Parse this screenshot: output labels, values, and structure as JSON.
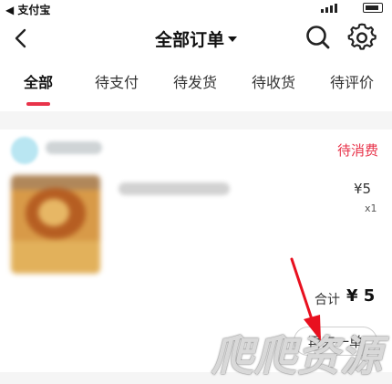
{
  "status_bar": {
    "back_label": "◀ 支付宝"
  },
  "header": {
    "title": "全部订单"
  },
  "tabs": [
    {
      "label": "全部",
      "active": true
    },
    {
      "label": "待支付",
      "active": false
    },
    {
      "label": "待发货",
      "active": false
    },
    {
      "label": "待收货",
      "active": false
    },
    {
      "label": "待评价",
      "active": false
    }
  ],
  "order": {
    "status": "待消费",
    "price": "¥5",
    "quantity": "x1",
    "total_label": "合计",
    "total_value": "¥ 5",
    "action_button": "再来一单"
  },
  "watermark": "爬爬资源",
  "colors": {
    "accent": "#e8334a",
    "background": "#ffffff",
    "divider": "#f5f5f5"
  },
  "icons": {
    "back": "chevron-left-icon",
    "search": "search-icon",
    "settings": "gear-icon",
    "title_caret": "caret-down-icon"
  }
}
